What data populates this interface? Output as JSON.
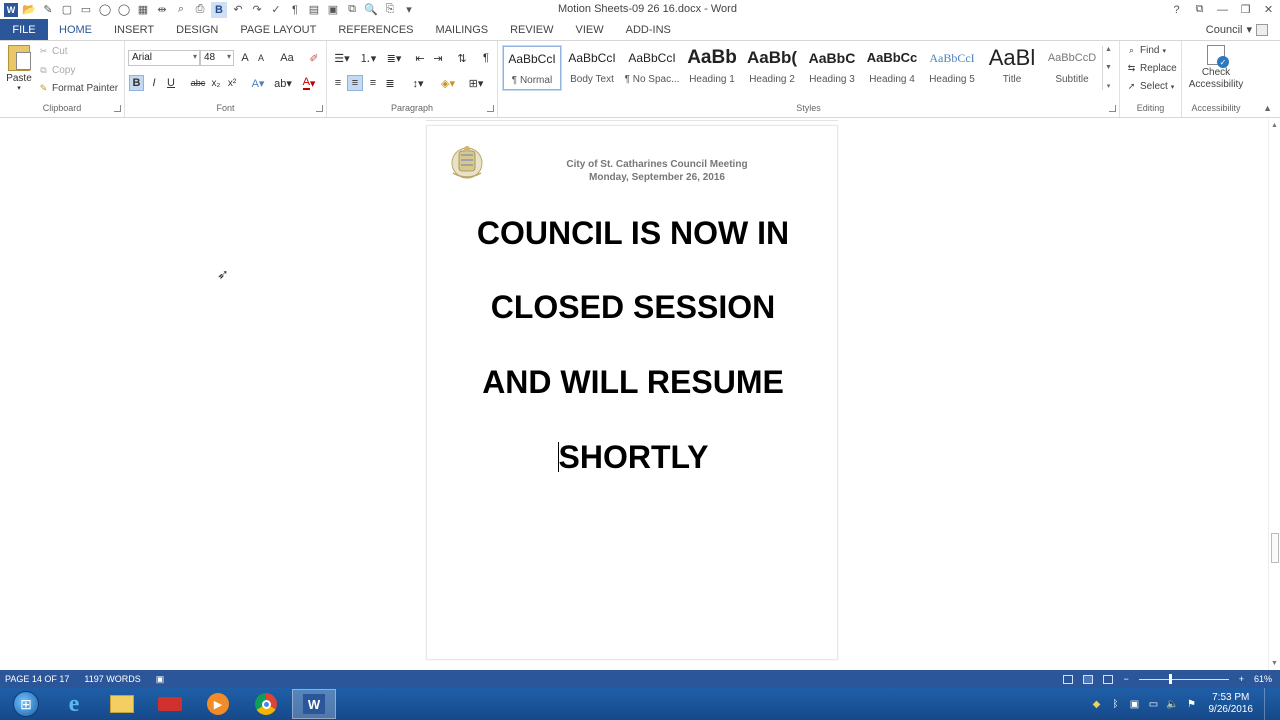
{
  "app": {
    "title": "Motion Sheets-09 26 16.docx - Word",
    "account_name": "Council"
  },
  "window_controls": {
    "help": "?",
    "ribbon_options": "⧉",
    "minimize": "—",
    "restore": "❐",
    "close": "✕"
  },
  "tabs": [
    {
      "label": "FILE"
    },
    {
      "label": "HOME"
    },
    {
      "label": "INSERT"
    },
    {
      "label": "DESIGN"
    },
    {
      "label": "PAGE LAYOUT"
    },
    {
      "label": "REFERENCES"
    },
    {
      "label": "MAILINGS"
    },
    {
      "label": "REVIEW"
    },
    {
      "label": "VIEW"
    },
    {
      "label": "ADD-INS"
    }
  ],
  "ribbon": {
    "clipboard": {
      "paste": "Paste",
      "cut": "Cut",
      "copy": "Copy",
      "format_painter": "Format Painter",
      "label": "Clipboard"
    },
    "font": {
      "family": "Arial",
      "size": "48",
      "label": "Font",
      "grow": "A",
      "shrink": "A",
      "case": "Aa",
      "bold": "B",
      "italic": "I",
      "underline": "U",
      "strike": "abc",
      "subscript": "x₂",
      "superscript": "x²",
      "font_color": "A"
    },
    "paragraph": {
      "label": "Paragraph"
    },
    "styles": {
      "label": "Styles",
      "items": [
        {
          "preview": "AaBbCcI",
          "name": "¶ Normal"
        },
        {
          "preview": "AaBbCcI",
          "name": "Body Text"
        },
        {
          "preview": "AaBbCcI",
          "name": "¶ No Spac..."
        },
        {
          "preview": "AaBb",
          "name": "Heading 1"
        },
        {
          "preview": "AaBb(",
          "name": "Heading 2"
        },
        {
          "preview": "AaBbC",
          "name": "Heading 3"
        },
        {
          "preview": "AaBbCc",
          "name": "Heading 4"
        },
        {
          "preview": "AaBbCcI",
          "name": "Heading 5"
        },
        {
          "preview": "AaBl",
          "name": "Title"
        },
        {
          "preview": "AaBbCcD",
          "name": "Subtitle"
        }
      ]
    },
    "editing": {
      "find": "Find",
      "replace": "Replace",
      "select": "Select",
      "label": "Editing"
    },
    "accessibility": {
      "check": "Check Accessibility",
      "label": "Accessibility"
    }
  },
  "document": {
    "header_line1": "City of St. Catharines Council Meeting",
    "header_line2": "Monday, September 26, 2016",
    "body_lines": [
      "COUNCIL IS NOW IN",
      "CLOSED SESSION",
      "AND WILL RESUME",
      "SHORTLY"
    ]
  },
  "statusbar": {
    "page": "PAGE 14 OF 17",
    "words": "1197 WORDS",
    "zoom": "61%",
    "zoom_fraction": 0.33
  },
  "taskbar": {
    "time": "7:53 PM",
    "date": "9/26/2016"
  }
}
